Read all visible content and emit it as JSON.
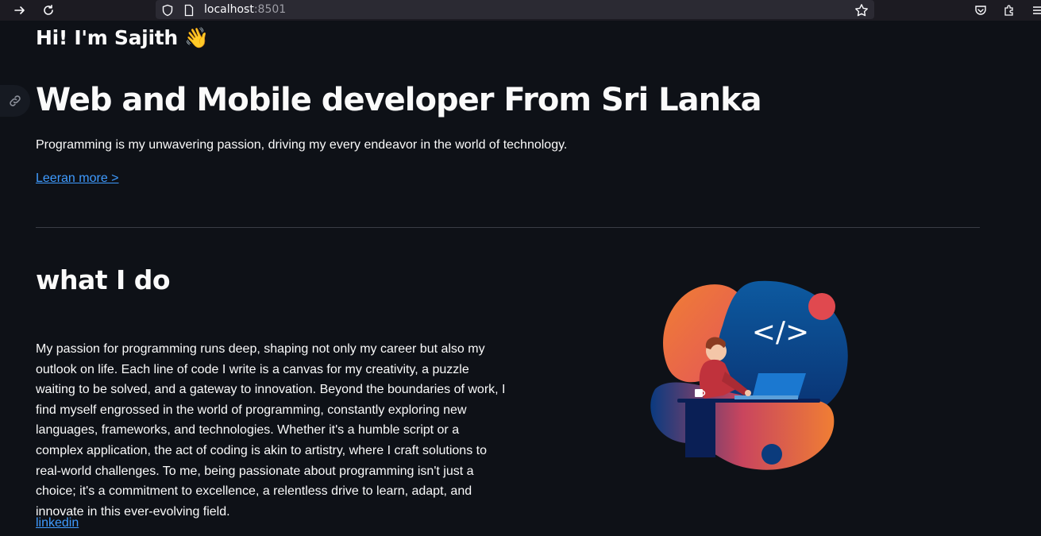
{
  "browser": {
    "url_host": "localhost",
    "url_port": ":8501",
    "icons": [
      "forward-arrow-icon",
      "reload-icon",
      "shield-icon",
      "page-icon",
      "bookmark-star-icon",
      "pocket-icon",
      "extensions-icon",
      "menu-icon"
    ]
  },
  "hero": {
    "greeting": "Hi! I'm Sajith 👋",
    "headline": "Web and Mobile developer From Sri Lanka",
    "tagline": "Programming is my unwavering passion, driving my every endeavor in the world of technology.",
    "learn_more": "Leeran more >"
  },
  "about": {
    "title": "what I do",
    "paragraph": "My passion for programming runs deep, shaping not only my career but also my outlook on life. Each line of code I write is a canvas for my creativity, a puzzle waiting to be solved, and a gateway to innovation. Beyond the boundaries of work, I find myself engrossed in the world of programming, constantly exploring new languages, frameworks, and technologies. Whether it's a humble script or a complex application, the act of coding is akin to artistry, where I craft solutions to real-world challenges. To me, being passionate about programming isn't just a choice; it's a commitment to excellence, a relentless drive to learn, adapt, and innovate in this ever-evolving field.",
    "linkedin": "linkedin",
    "code_glyph": "</>"
  },
  "colors": {
    "background": "#0e1117",
    "link": "#3f9bff",
    "text": "#fafafa"
  }
}
